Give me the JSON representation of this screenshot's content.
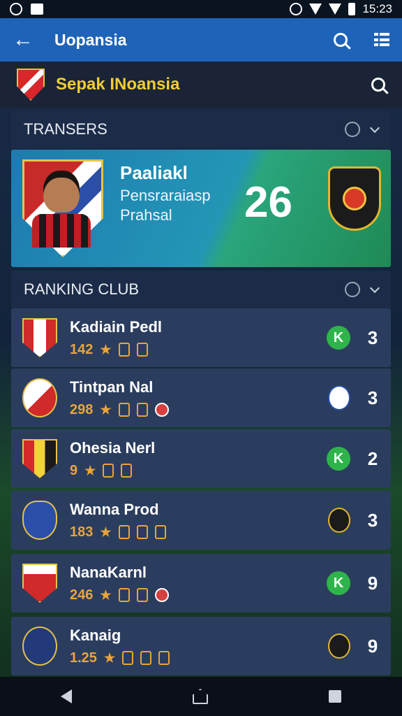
{
  "status_bar": {
    "time": "15:23"
  },
  "app_bar": {
    "title": "Uopansia"
  },
  "brand": {
    "name": "Sepak INoansia"
  },
  "transfers": {
    "section_label": "TRANSERS",
    "player_name": "Paaliakl",
    "player_line1": "Pensraraiasp",
    "player_line2": "Prahsal",
    "number": "26"
  },
  "ranking": {
    "section_label": "RANKING CLUB",
    "clubs": [
      {
        "name": "Kadiain Pedl",
        "stat": "142",
        "status_type": "K",
        "score": "3"
      },
      {
        "name": "Tintpan Nal",
        "stat": "298",
        "status_type": "crest",
        "score": "3"
      },
      {
        "name": "Ohesia Nerl",
        "stat": "9",
        "status_type": "K",
        "score": "2"
      },
      {
        "name": "Wanna Prod",
        "stat": "183",
        "status_type": "crest",
        "score": "3"
      },
      {
        "name": "NanaKarnl",
        "stat": "246",
        "status_type": "K",
        "score": "9"
      },
      {
        "name": "Kanaig",
        "stat": "1.25",
        "status_type": "crest",
        "score": "9"
      }
    ]
  }
}
